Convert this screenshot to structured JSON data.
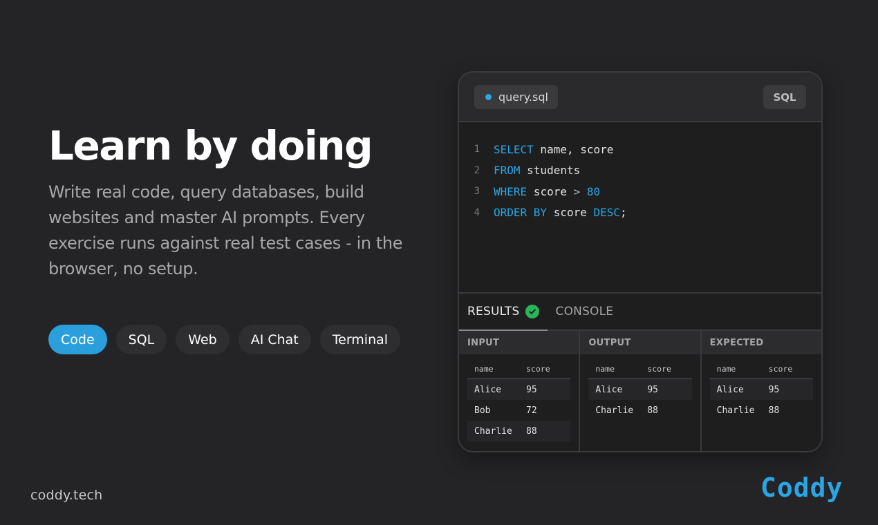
{
  "hero": {
    "title": "Learn by doing",
    "description": "Write real code, query databases, build websites and master AI prompts. Every exercise runs against real test cases - in the browser, no setup."
  },
  "chips": [
    {
      "label": "Code",
      "active": true
    },
    {
      "label": "SQL",
      "active": false
    },
    {
      "label": "Web",
      "active": false
    },
    {
      "label": "AI Chat",
      "active": false
    },
    {
      "label": "Terminal",
      "active": false
    }
  ],
  "footer": {
    "site": "coddy.tech",
    "brand": "Coddy"
  },
  "editor": {
    "filename": "query.sql",
    "language": "SQL",
    "code_lines": [
      {
        "n": "1",
        "k1": "SELECT",
        "t1": " name, score"
      },
      {
        "n": "2",
        "k1": "FROM",
        "t1": " students"
      },
      {
        "n": "3",
        "k1": "WHERE",
        "t1": " score ",
        "op": "> ",
        "num": "80"
      },
      {
        "n": "4",
        "k1": "ORDER BY",
        "t1": " score ",
        "k2": "DESC",
        "t2": ";"
      }
    ]
  },
  "results": {
    "tabs": [
      "RESULTS",
      "CONSOLE"
    ],
    "panels": [
      {
        "title": "INPUT",
        "columns": [
          "name",
          "score"
        ],
        "rows": [
          [
            "Alice",
            "95"
          ],
          [
            "Bob",
            "72"
          ],
          [
            "Charlie",
            "88"
          ]
        ]
      },
      {
        "title": "OUTPUT",
        "columns": [
          "name",
          "score"
        ],
        "rows": [
          [
            "Alice",
            "95"
          ],
          [
            "Charlie",
            "88"
          ]
        ]
      },
      {
        "title": "EXPECTED",
        "columns": [
          "name",
          "score"
        ],
        "rows": [
          [
            "Alice",
            "95"
          ],
          [
            "Charlie",
            "88"
          ]
        ]
      }
    ]
  },
  "colors": {
    "background": "#242426",
    "accent": "#2aa5e6",
    "success": "#29b55a"
  }
}
